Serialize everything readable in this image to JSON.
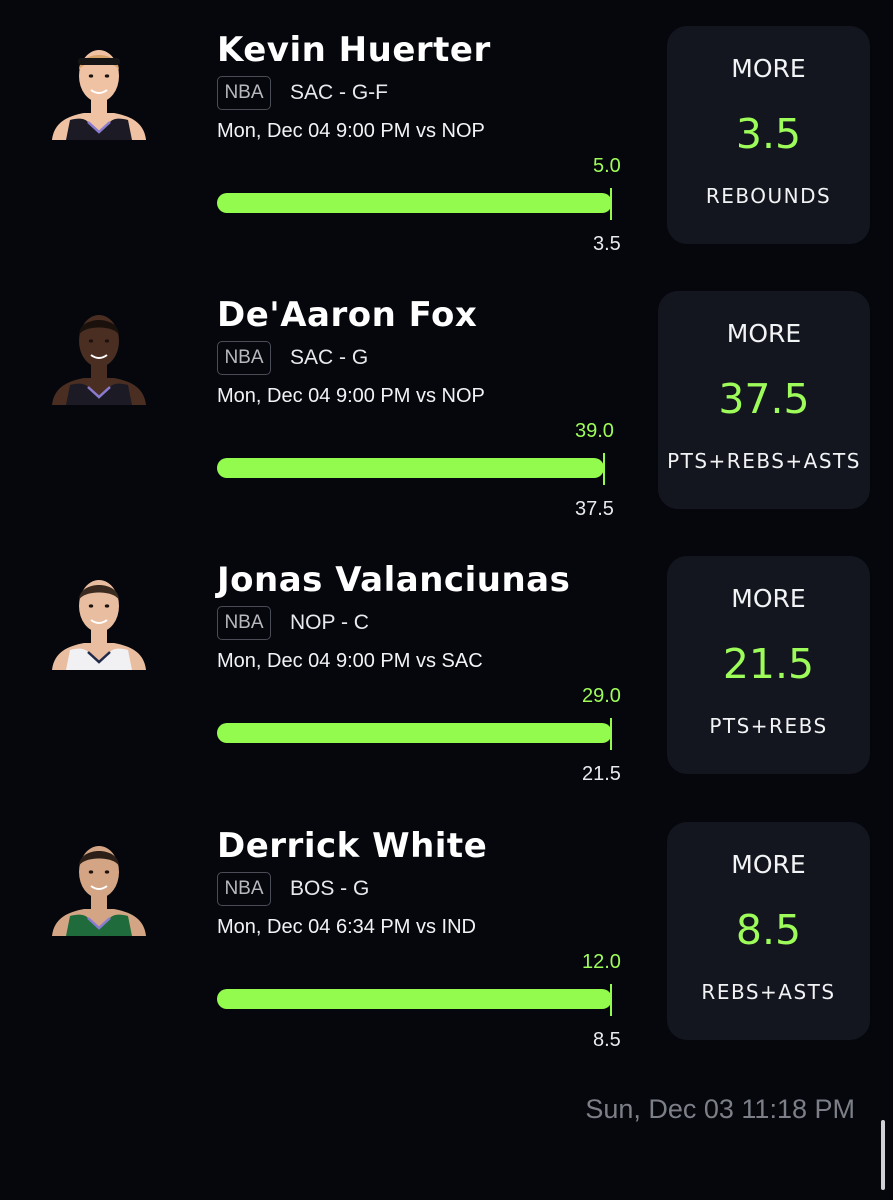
{
  "picks": [
    {
      "player": "Kevin Huerter",
      "league": "NBA",
      "team_position": "SAC - G-F",
      "game": "Mon, Dec 04 9:00 PM  vs NOP",
      "actual": "5.0",
      "line": "3.5",
      "progress": 1.0,
      "direction": "MORE",
      "stat": "REBOUNDS",
      "jersey_color": "#1c1a24",
      "skin_color": "#f0c2a4",
      "hair_color": "#d7a26a",
      "headband": true
    },
    {
      "player": "De'Aaron Fox",
      "league": "NBA",
      "team_position": "SAC - G",
      "game": "Mon, Dec 04 9:00 PM  vs NOP",
      "actual": "39.0",
      "line": "37.5",
      "progress": 1.0,
      "direction": "MORE",
      "stat": "PTS+REBS+ASTS",
      "jersey_color": "#1c1a24",
      "skin_color": "#4a2e22",
      "hair_color": "#1a110d",
      "headband": false
    },
    {
      "player": "Jonas Valanciunas",
      "league": "NBA",
      "team_position": "NOP - C",
      "game": "Mon, Dec 04 9:00 PM  vs SAC",
      "actual": "29.0",
      "line": "21.5",
      "progress": 1.0,
      "direction": "MORE",
      "stat": "PTS+REBS",
      "jersey_color": "#f1f1f3",
      "skin_color": "#e9bda0",
      "hair_color": "#3a2a20",
      "headband": false
    },
    {
      "player": "Derrick White",
      "league": "NBA",
      "team_position": "BOS - G",
      "game": "Mon, Dec 04 6:34 PM  vs IND",
      "actual": "12.0",
      "line": "8.5",
      "progress": 1.0,
      "direction": "MORE",
      "stat": "REBS+ASTS",
      "jersey_color": "#1f6b3c",
      "skin_color": "#d4a585",
      "hair_color": "#2b1f18",
      "headband": false
    }
  ],
  "timestamp": "Sun, Dec 03 11:18 PM",
  "colors": {
    "accent": "#93fa4e",
    "background": "#05070d",
    "card": "#13161e"
  }
}
